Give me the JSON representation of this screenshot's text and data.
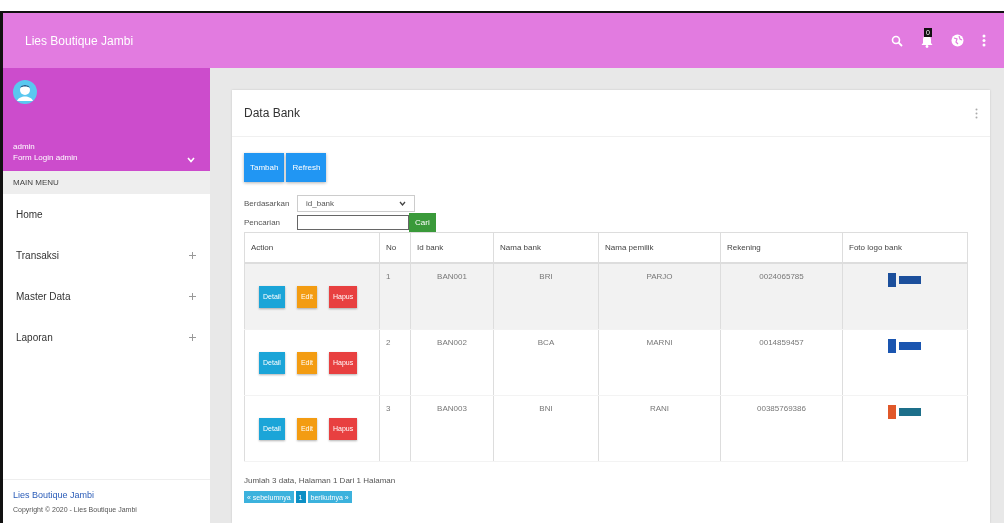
{
  "header": {
    "title": "Lies Boutique Jambi",
    "notification_count": "0"
  },
  "sidebar": {
    "user_name": "admin",
    "user_role": "Form Login admin",
    "section": "MAIN MENU",
    "items": [
      {
        "label": "Home",
        "expandable": false
      },
      {
        "label": "Transaksi",
        "expandable": true
      },
      {
        "label": "Master Data",
        "expandable": true
      },
      {
        "label": "Laporan",
        "expandable": true
      }
    ],
    "footer_title": "Lies Boutique Jambi",
    "footer_text": "Copyright © 2020 - Lies Boutique Jambi"
  },
  "card": {
    "title": "Data Bank",
    "buttons": [
      "Tambah",
      "Refresh"
    ],
    "filter": {
      "label": "Berdasarkan",
      "value": "id_bank"
    },
    "search": {
      "label": "Pencarian",
      "button": "Cari"
    },
    "table": {
      "columns": [
        "Action",
        "No",
        "Id bank",
        "Nama bank",
        "Nama pemilik",
        "Rekening",
        "Foto logo bank"
      ],
      "rows": [
        {
          "actions": [
            {
              "label": "Detail",
              "kind": "detail"
            },
            {
              "label": "Edit",
              "kind": "edit"
            },
            {
              "label": "Hapus",
              "kind": "delete"
            }
          ],
          "no": "1",
          "id": "BAN001",
          "bank": "BRI",
          "owner": "PARJO",
          "account": "0024065785",
          "logo": {
            "kind": "bri"
          },
          "selected": true
        },
        {
          "actions": [
            {
              "label": "Detail",
              "kind": "detail"
            },
            {
              "label": "Edit",
              "kind": "edit"
            },
            {
              "label": "Hapus",
              "kind": "delete"
            }
          ],
          "no": "2",
          "id": "BAN002",
          "bank": "BCA",
          "owner": "MARNI",
          "account": "0014859457",
          "logo": {
            "kind": "bca"
          },
          "selected": false
        },
        {
          "actions": [
            {
              "label": "Detail",
              "kind": "detail"
            },
            {
              "label": "Edit",
              "kind": "edit"
            },
            {
              "label": "Hapus",
              "kind": "delete"
            }
          ],
          "no": "3",
          "id": "BAN003",
          "bank": "BNI",
          "owner": "RANI",
          "account": "00385769386",
          "logo": {
            "kind": "bni"
          },
          "selected": false
        }
      ]
    },
    "summary": "Jumlah 3 data, Halaman 1 Dari 1 Halaman",
    "pagination": [
      {
        "label": "« sebelumnya",
        "selected": false
      },
      {
        "label": "1",
        "selected": true
      },
      {
        "label": "berikutnya »",
        "selected": false
      }
    ]
  }
}
